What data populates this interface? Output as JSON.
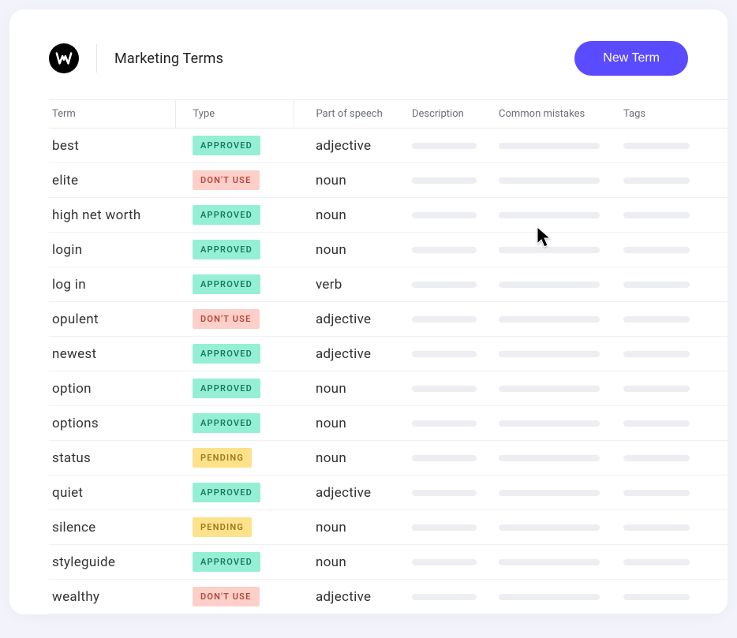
{
  "header": {
    "title": "Marketing Terms",
    "new_term_label": "New Term"
  },
  "columns": {
    "term": "Term",
    "type": "Type",
    "pos": "Part of speech",
    "desc": "Description",
    "mistakes": "Common mistakes",
    "tags": "Tags"
  },
  "badge_labels": {
    "approved": "APPROVED",
    "dontuse": "DON'T USE",
    "pending": "PENDING"
  },
  "rows": [
    {
      "term": "best",
      "type": "approved",
      "pos": "adjective"
    },
    {
      "term": "elite",
      "type": "dontuse",
      "pos": "noun"
    },
    {
      "term": "high net worth",
      "type": "approved",
      "pos": "noun"
    },
    {
      "term": "login",
      "type": "approved",
      "pos": "noun"
    },
    {
      "term": "log in",
      "type": "approved",
      "pos": "verb"
    },
    {
      "term": "opulent",
      "type": "dontuse",
      "pos": "adjective"
    },
    {
      "term": "newest",
      "type": "approved",
      "pos": "adjective"
    },
    {
      "term": "option",
      "type": "approved",
      "pos": "noun"
    },
    {
      "term": "options",
      "type": "approved",
      "pos": "noun"
    },
    {
      "term": "status",
      "type": "pending",
      "pos": "noun"
    },
    {
      "term": "quiet",
      "type": "approved",
      "pos": "adjective"
    },
    {
      "term": "silence",
      "type": "pending",
      "pos": "noun"
    },
    {
      "term": "styleguide",
      "type": "approved",
      "pos": "noun"
    },
    {
      "term": "wealthy",
      "type": "dontuse",
      "pos": "adjective"
    }
  ]
}
